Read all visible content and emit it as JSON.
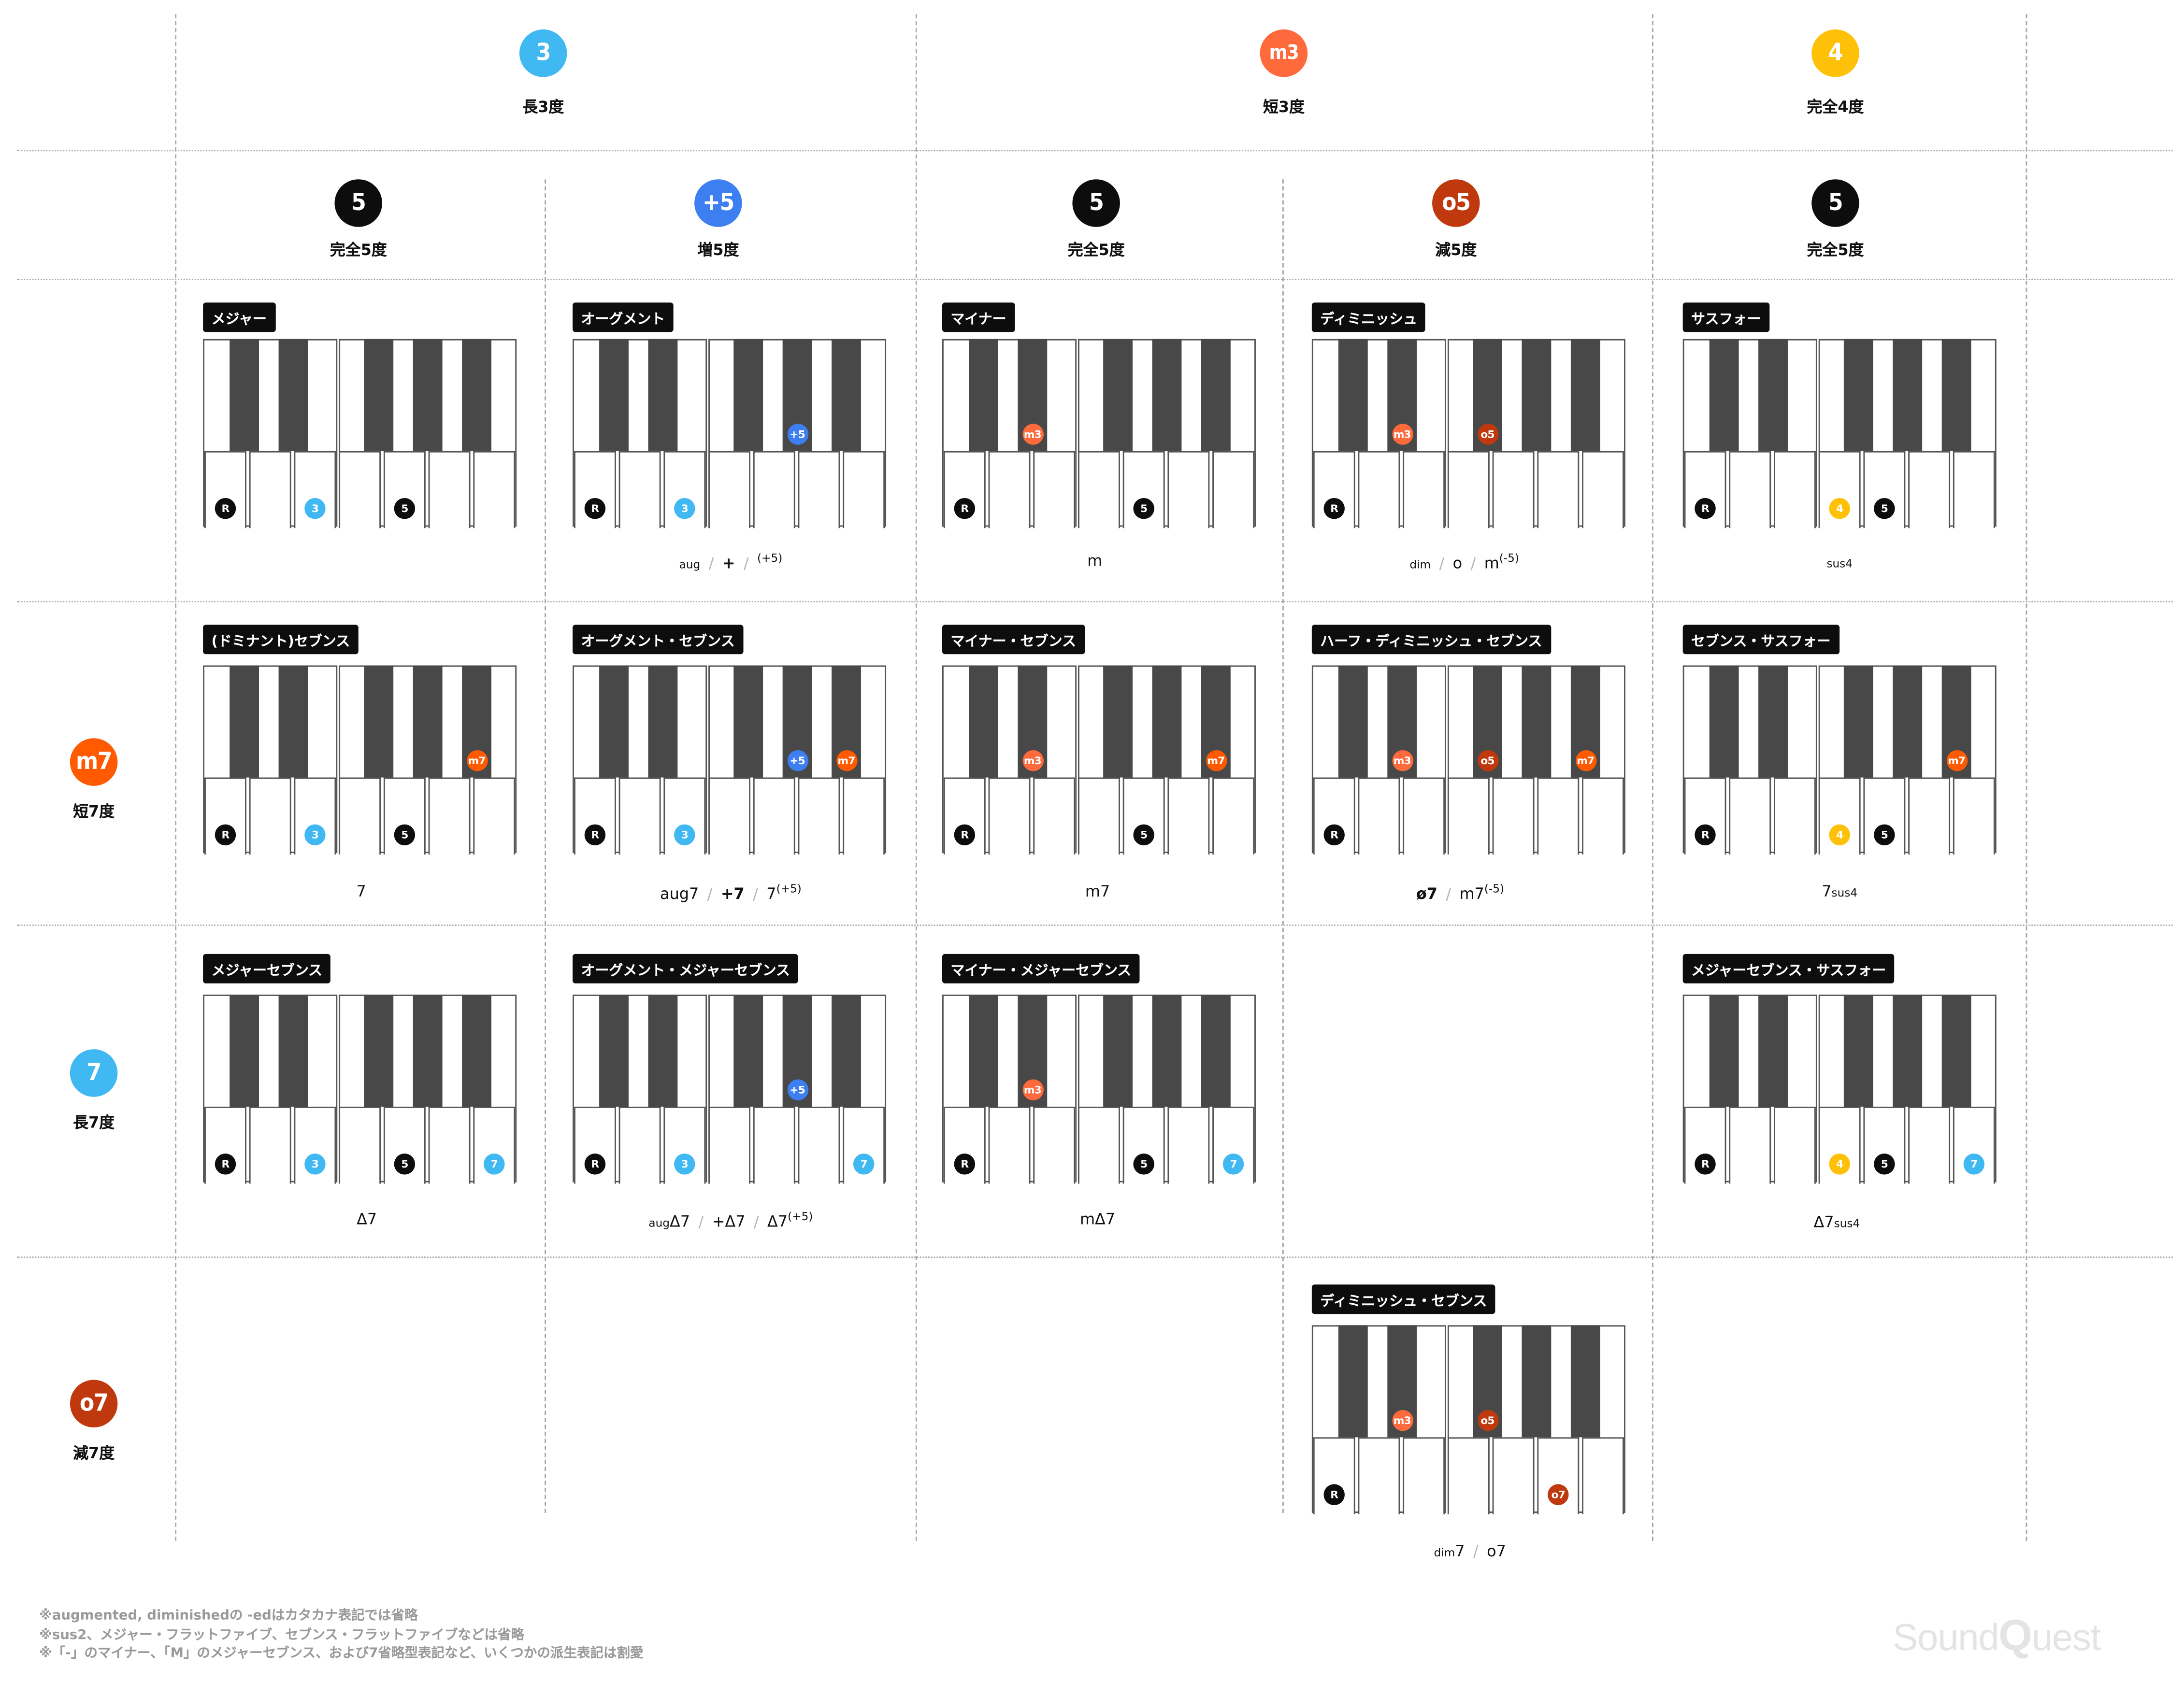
{
  "colors": {
    "root": "#0d0d0d",
    "third_major": "#40b8f2",
    "third_minor": "#ff6a3d",
    "fourth": "#ffc107",
    "fifth_perfect": "#0d0d0d",
    "fifth_aug": "#3d7ef0",
    "fifth_dim": "#c0390e",
    "seventh_minor": "#ff5a00",
    "seventh_major": "#40b8f2",
    "seventh_dim": "#c0390e",
    "black_key": "#484848",
    "grid_line": "#a8a8a8"
  },
  "header": {
    "thirds": [
      {
        "badge": "3",
        "label": "長3度"
      },
      {
        "badge": "m3",
        "label": "短3度"
      },
      {
        "badge": "4",
        "label": "完全4度"
      }
    ],
    "fifths": [
      {
        "badge": "5",
        "label": "完全5度"
      },
      {
        "badge": "+5",
        "label": "増5度"
      },
      {
        "badge": "5",
        "label": "完全5度"
      },
      {
        "badge": "o5",
        "label": "減5度"
      },
      {
        "badge": "5",
        "label": "完全5度"
      }
    ]
  },
  "sevenths": [
    {
      "badge": "m7",
      "label": "短7度"
    },
    {
      "badge": "7",
      "label": "長7度"
    },
    {
      "badge": "o7",
      "label": "減7度"
    }
  ],
  "chords": [
    {
      "title": "メジャー",
      "notes": [
        "R",
        "3",
        "5"
      ],
      "symbol": {
        "parts": [
          "M_TRIAD"
        ]
      },
      "symbol_text": ""
    },
    {
      "title": "オーグメント",
      "notes": [
        "R",
        "3",
        "+5"
      ]
    },
    {
      "title": "マイナー",
      "notes": [
        "R",
        "m3",
        "5"
      ]
    },
    {
      "title": "ディミニッシュ",
      "notes": [
        "R",
        "m3",
        "o5"
      ]
    },
    {
      "title": "サスフォー",
      "notes": [
        "R",
        "4",
        "5"
      ]
    },
    {
      "title": "(ドミナント)セブンス",
      "notes": [
        "R",
        "3",
        "5",
        "m7"
      ]
    },
    {
      "title": "オーグメント・セブンス",
      "notes": [
        "R",
        "3",
        "+5",
        "m7"
      ]
    },
    {
      "title": "マイナー・セブンス",
      "notes": [
        "R",
        "m3",
        "5",
        "m7"
      ]
    },
    {
      "title": "ハーフ・ディミニッシュ・セブンス",
      "notes": [
        "R",
        "m3",
        "o5",
        "m7"
      ]
    },
    {
      "title": "セブンス・サスフォー",
      "notes": [
        "R",
        "4",
        "5",
        "m7"
      ]
    },
    {
      "title": "メジャーセブンス",
      "notes": [
        "R",
        "3",
        "5",
        "7"
      ]
    },
    {
      "title": "オーグメント・メジャーセブンス",
      "notes": [
        "R",
        "3",
        "+5",
        "7"
      ]
    },
    {
      "title": "マイナー・メジャーセブンス",
      "notes": [
        "R",
        "m3",
        "5",
        "7"
      ]
    },
    {
      "title": "メジャーセブンス・サスフォー",
      "notes": [
        "R",
        "4",
        "5",
        "7"
      ]
    },
    {
      "title": "ディミニッシュ・セブンス",
      "notes": [
        "R",
        "m3",
        "o5",
        "o7"
      ]
    }
  ],
  "symbols": {
    "major": "",
    "aug": {
      "a": "aug",
      "b": "+",
      "c_sup": "(+5)"
    },
    "minor": "m",
    "dim": {
      "a": "dim",
      "b": "o",
      "c": "m",
      "c_sup": "(-5)"
    },
    "sus4": "sus4",
    "dom7": "7",
    "aug7": {
      "a": "aug7",
      "b": "+7",
      "c": "7",
      "c_sup": "(+5)"
    },
    "m7": "m7",
    "half_dim": {
      "a": "ø7",
      "b": "m7",
      "b_sup": "(-5)"
    },
    "sus4_7": {
      "a": "7",
      "b_sub": "sus4"
    },
    "maj7": "Δ7",
    "augmaj7": {
      "a_small": "aug",
      "a": "Δ7",
      "b": "+Δ7",
      "c": "Δ7",
      "c_sup": "(+5)"
    },
    "mmaj7": "mΔ7",
    "maj7sus4": {
      "a": "Δ7",
      "b_sub": "sus4"
    },
    "dim7": {
      "a_small": "dim",
      "a": "7",
      "b": "o7"
    }
  },
  "notes": [
    "※augmented, diminishedの -edはカタカナ表記では省略",
    "※sus2、メジャー・フラットファイブ、セブンス・フラットファイブなどは省略",
    "※「-」のマイナー、「M」のメジャーセブンス、および7省略型表記など、いくつかの派生表記は割愛"
  ],
  "logo": {
    "part1": "Sound",
    "q": "Q",
    "part2": "uest"
  }
}
